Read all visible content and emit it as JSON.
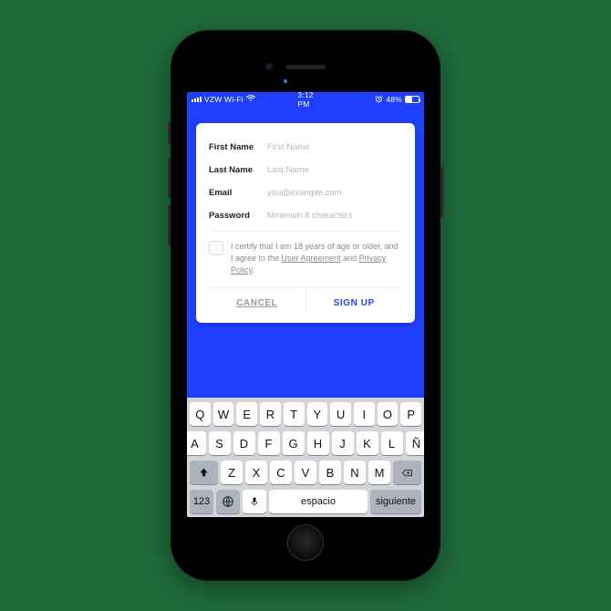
{
  "status_bar": {
    "carrier": "VZW Wi-Fi",
    "time": "3:12 PM",
    "battery_pct": "48%"
  },
  "form": {
    "first_name": {
      "label": "First Name",
      "placeholder": "First Name",
      "value": ""
    },
    "last_name": {
      "label": "Last Name",
      "placeholder": "Last Name",
      "value": ""
    },
    "email": {
      "label": "Email",
      "placeholder": "you@example.com",
      "value": ""
    },
    "password": {
      "label": "Password",
      "placeholder": "Minimum 8 characters",
      "value": ""
    }
  },
  "consent": {
    "prefix": "I certify that I am 18 years of age or older, and I agree to the ",
    "link1": "User Agreement",
    "middle": " and ",
    "link2": "Privacy Policy",
    "suffix": "."
  },
  "actions": {
    "cancel": "CANCEL",
    "signup": "SIGN UP"
  },
  "keyboard": {
    "row1": [
      "Q",
      "W",
      "E",
      "R",
      "T",
      "Y",
      "U",
      "I",
      "O",
      "P"
    ],
    "row2": [
      "A",
      "S",
      "D",
      "F",
      "G",
      "H",
      "J",
      "K",
      "L",
      "Ñ"
    ],
    "row3": [
      "Z",
      "X",
      "C",
      "V",
      "B",
      "N",
      "M"
    ],
    "numbers": "123",
    "space": "espacio",
    "next": "siguiente"
  },
  "colors": {
    "accent": "#1e3fff"
  }
}
